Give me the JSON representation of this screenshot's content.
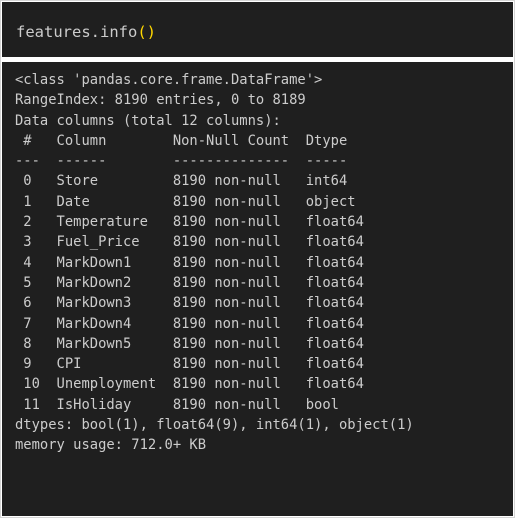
{
  "input": {
    "object": "features",
    "method": ".info",
    "open_paren": "(",
    "close_paren": ")"
  },
  "output": {
    "lines": [
      "<class 'pandas.core.frame.DataFrame'>",
      "RangeIndex: 8190 entries, 0 to 8189",
      "Data columns (total 12 columns):",
      " #   Column        Non-Null Count  Dtype  ",
      "---  ------        --------------  -----  ",
      " 0   Store         8190 non-null   int64  ",
      " 1   Date          8190 non-null   object ",
      " 2   Temperature   8190 non-null   float64",
      " 3   Fuel_Price    8190 non-null   float64",
      " 4   MarkDown1     8190 non-null   float64",
      " 5   MarkDown2     8190 non-null   float64",
      " 6   MarkDown3     8190 non-null   float64",
      " 7   MarkDown4     8190 non-null   float64",
      " 8   MarkDown5     8190 non-null   float64",
      " 9   CPI           8190 non-null   float64",
      " 10  Unemployment  8190 non-null   float64",
      " 11  IsHoliday     8190 non-null   bool   ",
      "dtypes: bool(1), float64(9), int64(1), object(1)",
      "memory usage: 712.0+ KB"
    ]
  },
  "colors": {
    "cell_background": "#1f1f1f",
    "text": "#cccccc",
    "parentheses": "#ffd700"
  }
}
